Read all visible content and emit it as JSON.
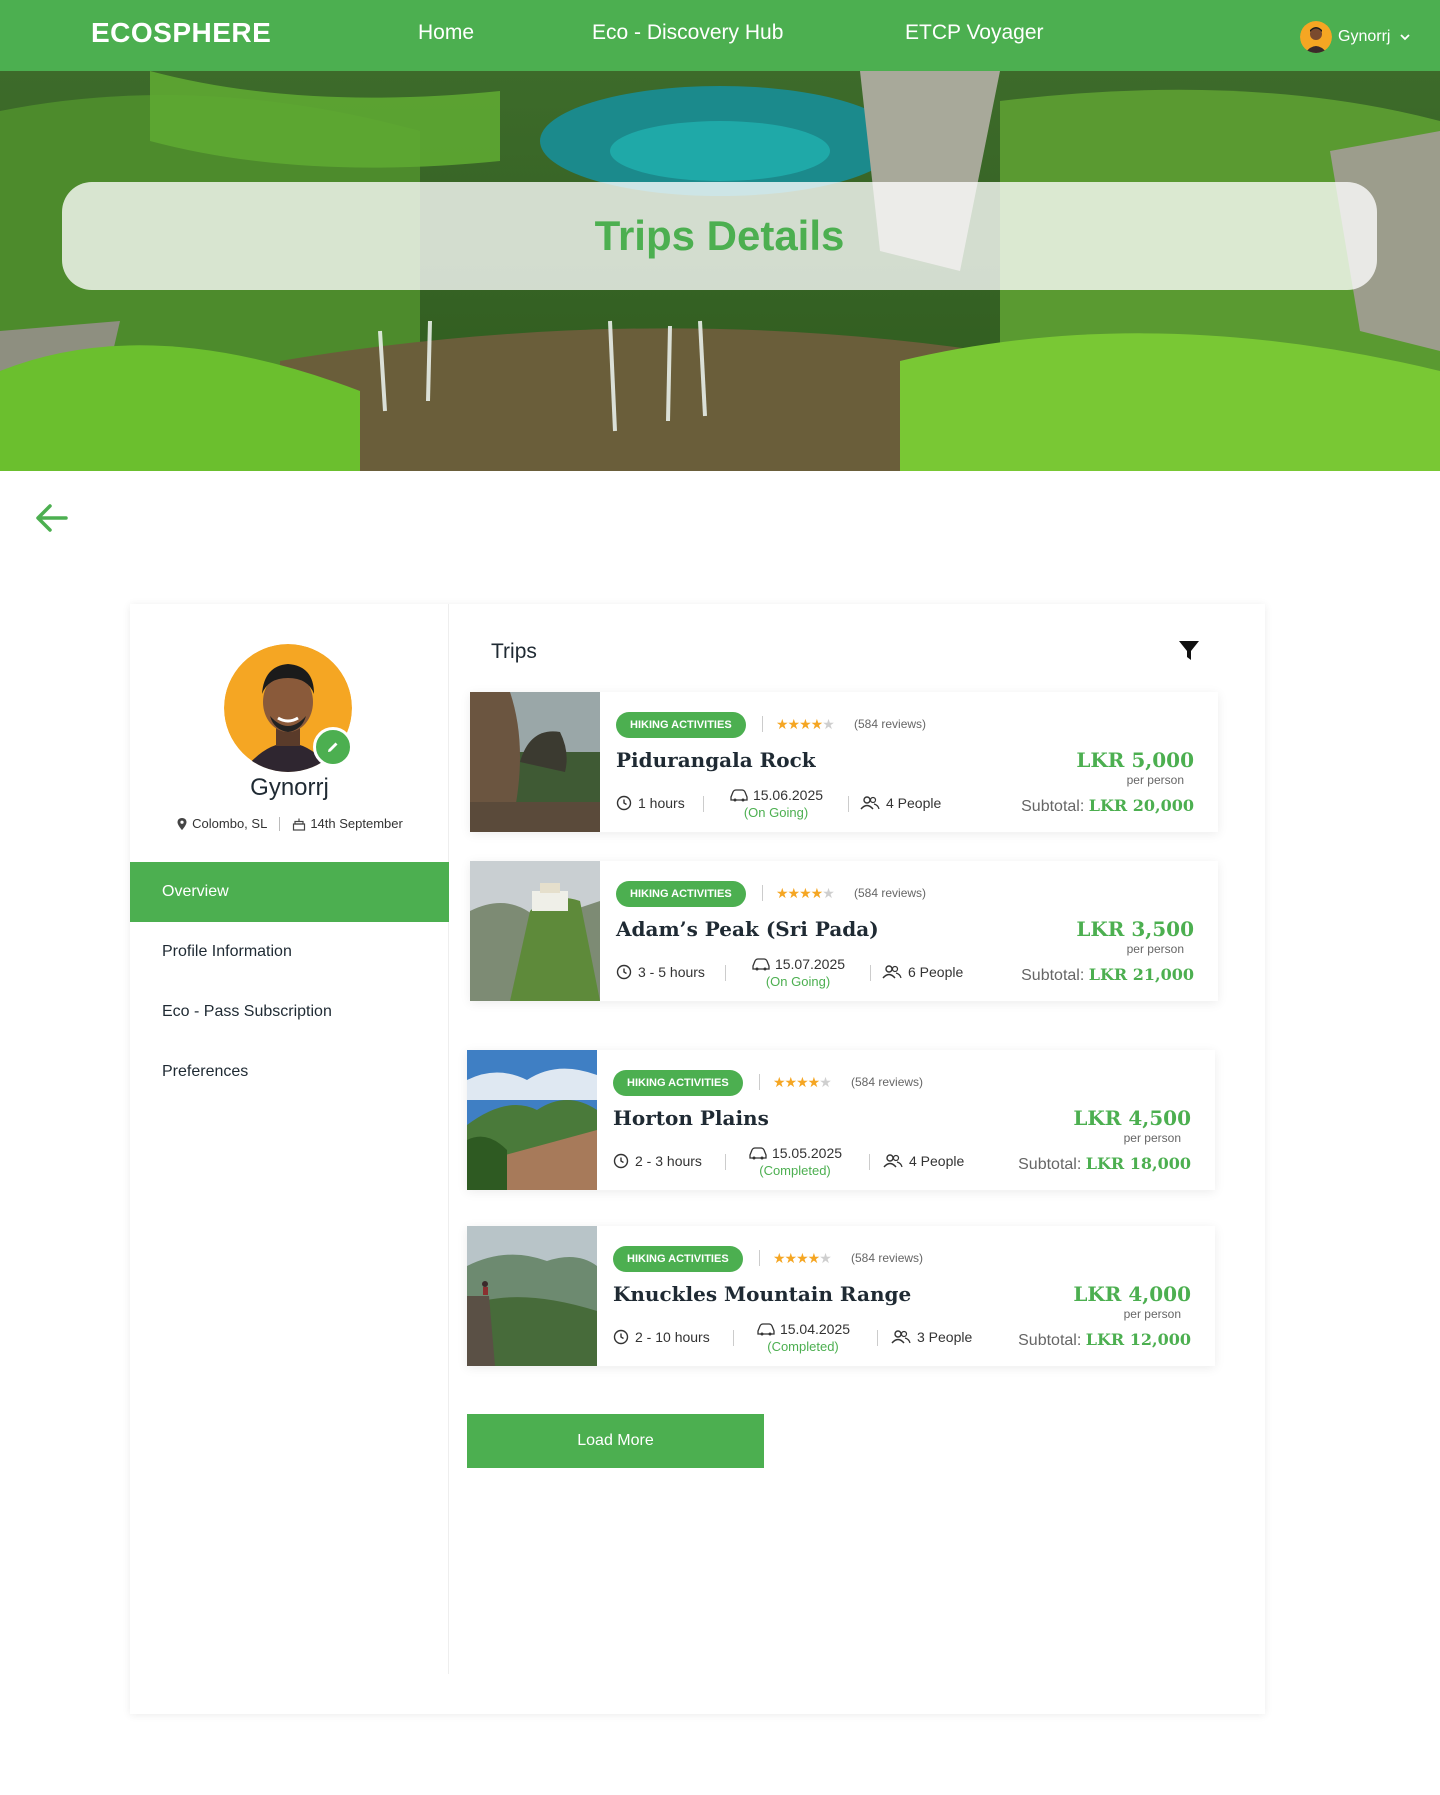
{
  "brand": "ECOSPHERE",
  "nav": {
    "home": "Home",
    "discovery": "Eco - Discovery Hub",
    "voyager": "ETCP Voyager",
    "user_name": "Gynorrj"
  },
  "hero": {
    "title": "Trips Details"
  },
  "profile": {
    "name": "Gynorrj",
    "location": "Colombo, SL",
    "birthday": "14th September"
  },
  "sidebar": {
    "items": [
      {
        "label": "Overview",
        "active": true
      },
      {
        "label": "Profile Information",
        "active": false
      },
      {
        "label": "Eco - Pass Subscription",
        "active": false
      },
      {
        "label": "Preferences",
        "active": false
      }
    ]
  },
  "trips_section": {
    "title": "Trips",
    "load_more": "Load More"
  },
  "trips": [
    {
      "tag": "HIKING ACTIVITIES",
      "rating": 4,
      "reviews": "(584 reviews)",
      "name": "Pidurangala Rock",
      "duration": "1 hours",
      "date": "15.06.2025",
      "status": "(On Going)",
      "people": "4 People",
      "price": "LKR 5,000",
      "per_person": "per person",
      "subtotal_label": "Subtotal:",
      "subtotal": "LKR 20,000"
    },
    {
      "tag": "HIKING ACTIVITIES",
      "rating": 4,
      "reviews": "(584 reviews)",
      "name": "Adam’s Peak (Sri Pada)",
      "duration": "3 - 5 hours",
      "date": "15.07.2025",
      "status": "(On Going)",
      "people": "6 People",
      "price": "LKR 3,500",
      "per_person": "per person",
      "subtotal_label": "Subtotal:",
      "subtotal": "LKR 21,000"
    },
    {
      "tag": "HIKING ACTIVITIES",
      "rating": 4,
      "reviews": "(584 reviews)",
      "name": "Horton Plains",
      "duration": "2 - 3 hours",
      "date": "15.05.2025",
      "status": "(Completed)",
      "people": "4 People",
      "price": "LKR 4,500",
      "per_person": "per person",
      "subtotal_label": "Subtotal:",
      "subtotal": "LKR 18,000"
    },
    {
      "tag": "HIKING ACTIVITIES",
      "rating": 4,
      "reviews": "(584 reviews)",
      "name": "Knuckles Mountain Range",
      "duration": "2 - 10 hours",
      "date": "15.04.2025",
      "status": "(Completed)",
      "people": "3 People",
      "price": "LKR 4,000",
      "per_person": "per person",
      "subtotal_label": "Subtotal:",
      "subtotal": "LKR 12,000"
    }
  ],
  "colors": {
    "accent": "#4caf50",
    "star": "#f5a623",
    "text": "#1f2a33"
  }
}
